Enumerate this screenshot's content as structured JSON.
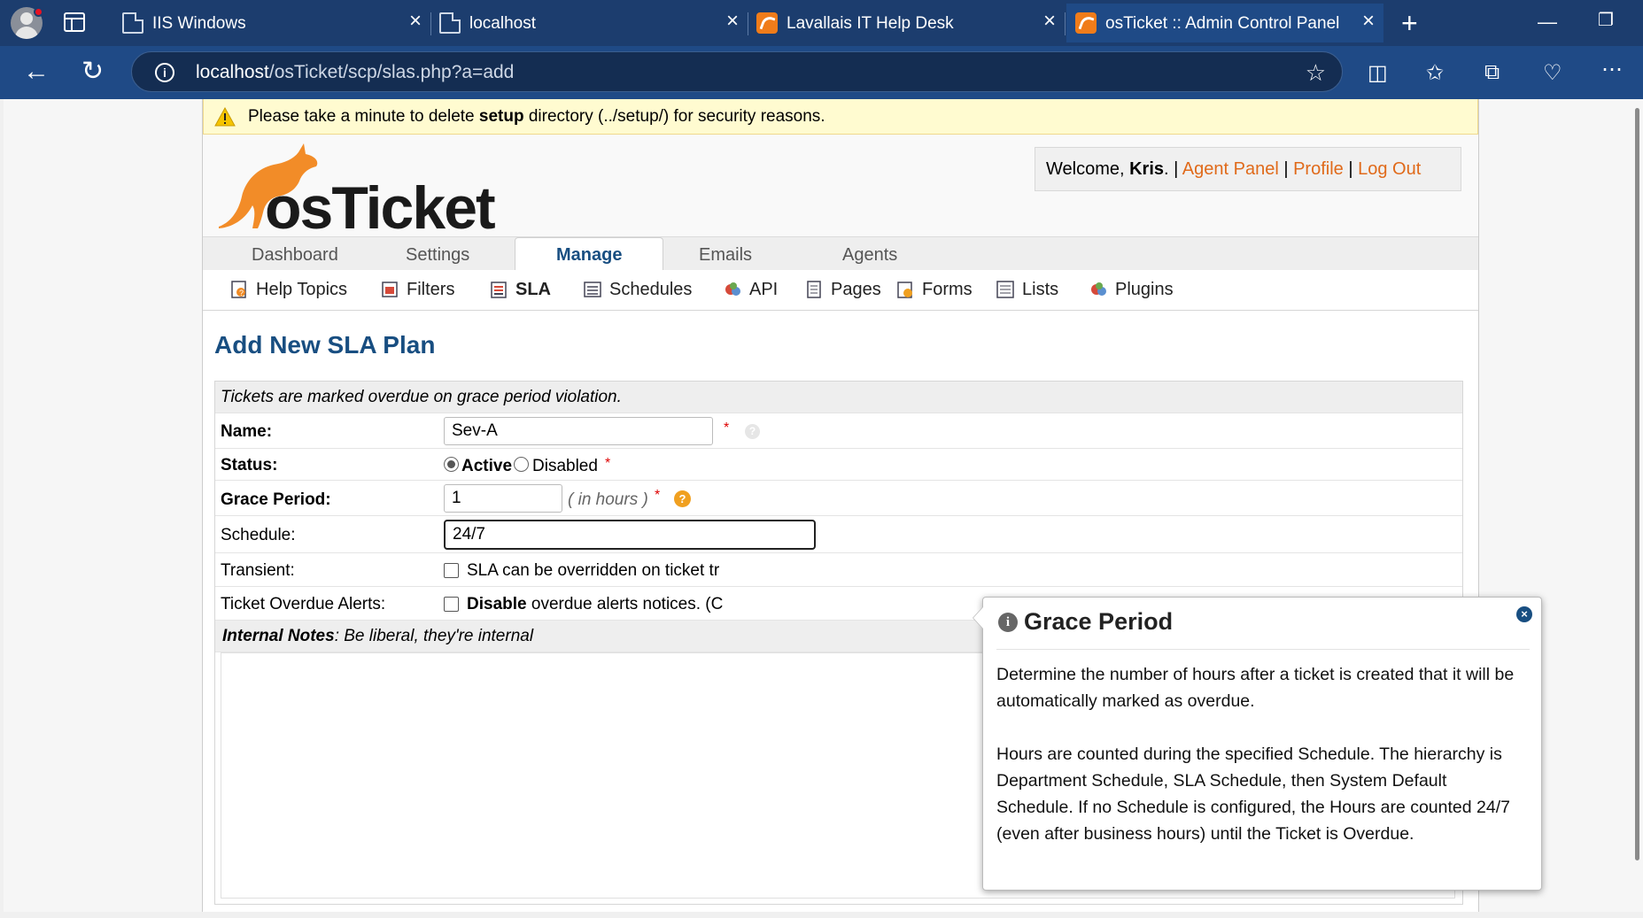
{
  "browser": {
    "tabs": [
      {
        "title": "IIS Windows"
      },
      {
        "title": "localhost"
      },
      {
        "title": "Lavallais IT Help Desk"
      },
      {
        "title": "osTicket :: Admin Control Panel"
      }
    ],
    "url_host": "localhost",
    "url_path": "/osTicket/scp/slas.php?a=add"
  },
  "warning": {
    "text_before": "Please take a minute to delete ",
    "text_bold": "setup",
    "text_after": " directory (../setup/) for security reasons."
  },
  "header": {
    "logo_text": "osTicket",
    "welcome_prefix": "Welcome, ",
    "user_name": "Kris",
    "welcome_suffix": ". |",
    "agent_panel": "Agent Panel",
    "profile": "Profile",
    "logout": "Log Out",
    "sep1": "|",
    "sep2": "|"
  },
  "nav": {
    "tabs": [
      "Dashboard",
      "Settings",
      "Manage",
      "Emails",
      "Agents"
    ],
    "active": "Manage"
  },
  "subnav": {
    "items": [
      "Help Topics",
      "Filters",
      "SLA",
      "Schedules",
      "API",
      "Pages",
      "Forms",
      "Lists",
      "Plugins"
    ],
    "active": "SLA"
  },
  "page": {
    "title": "Add New SLA Plan"
  },
  "form": {
    "header_note": "Tickets are marked overdue on grace period violation.",
    "name_label": "Name:",
    "name_value": "Sev-A",
    "status_label": "Status:",
    "status_active": "Active",
    "status_disabled": "Disabled",
    "grace_label": "Grace Period:",
    "grace_value": "1",
    "grace_unit": "( in hours )",
    "schedule_label": "Schedule:",
    "schedule_value": "24/7",
    "transient_label": "Transient:",
    "transient_text": "SLA can be overridden on ticket tr",
    "alerts_label": "Ticket Overdue Alerts:",
    "alerts_bold": "Disable",
    "alerts_text": " overdue alerts notices. (C",
    "notes_label": "Internal Notes",
    "notes_hint": ": Be liberal, they're internal",
    "required_mark": "*"
  },
  "tooltip": {
    "title": "Grace Period",
    "paragraph1": "Determine the number of hours after a ticket is created that it will be automatically marked as overdue.",
    "paragraph2": "Hours are counted during the specified Schedule. The hierarchy is Department Schedule, SLA Schedule, then System Default Schedule. If no Schedule is configured, the Hours are counted 24/7 (even after business hours) until the Ticket is Overdue."
  }
}
